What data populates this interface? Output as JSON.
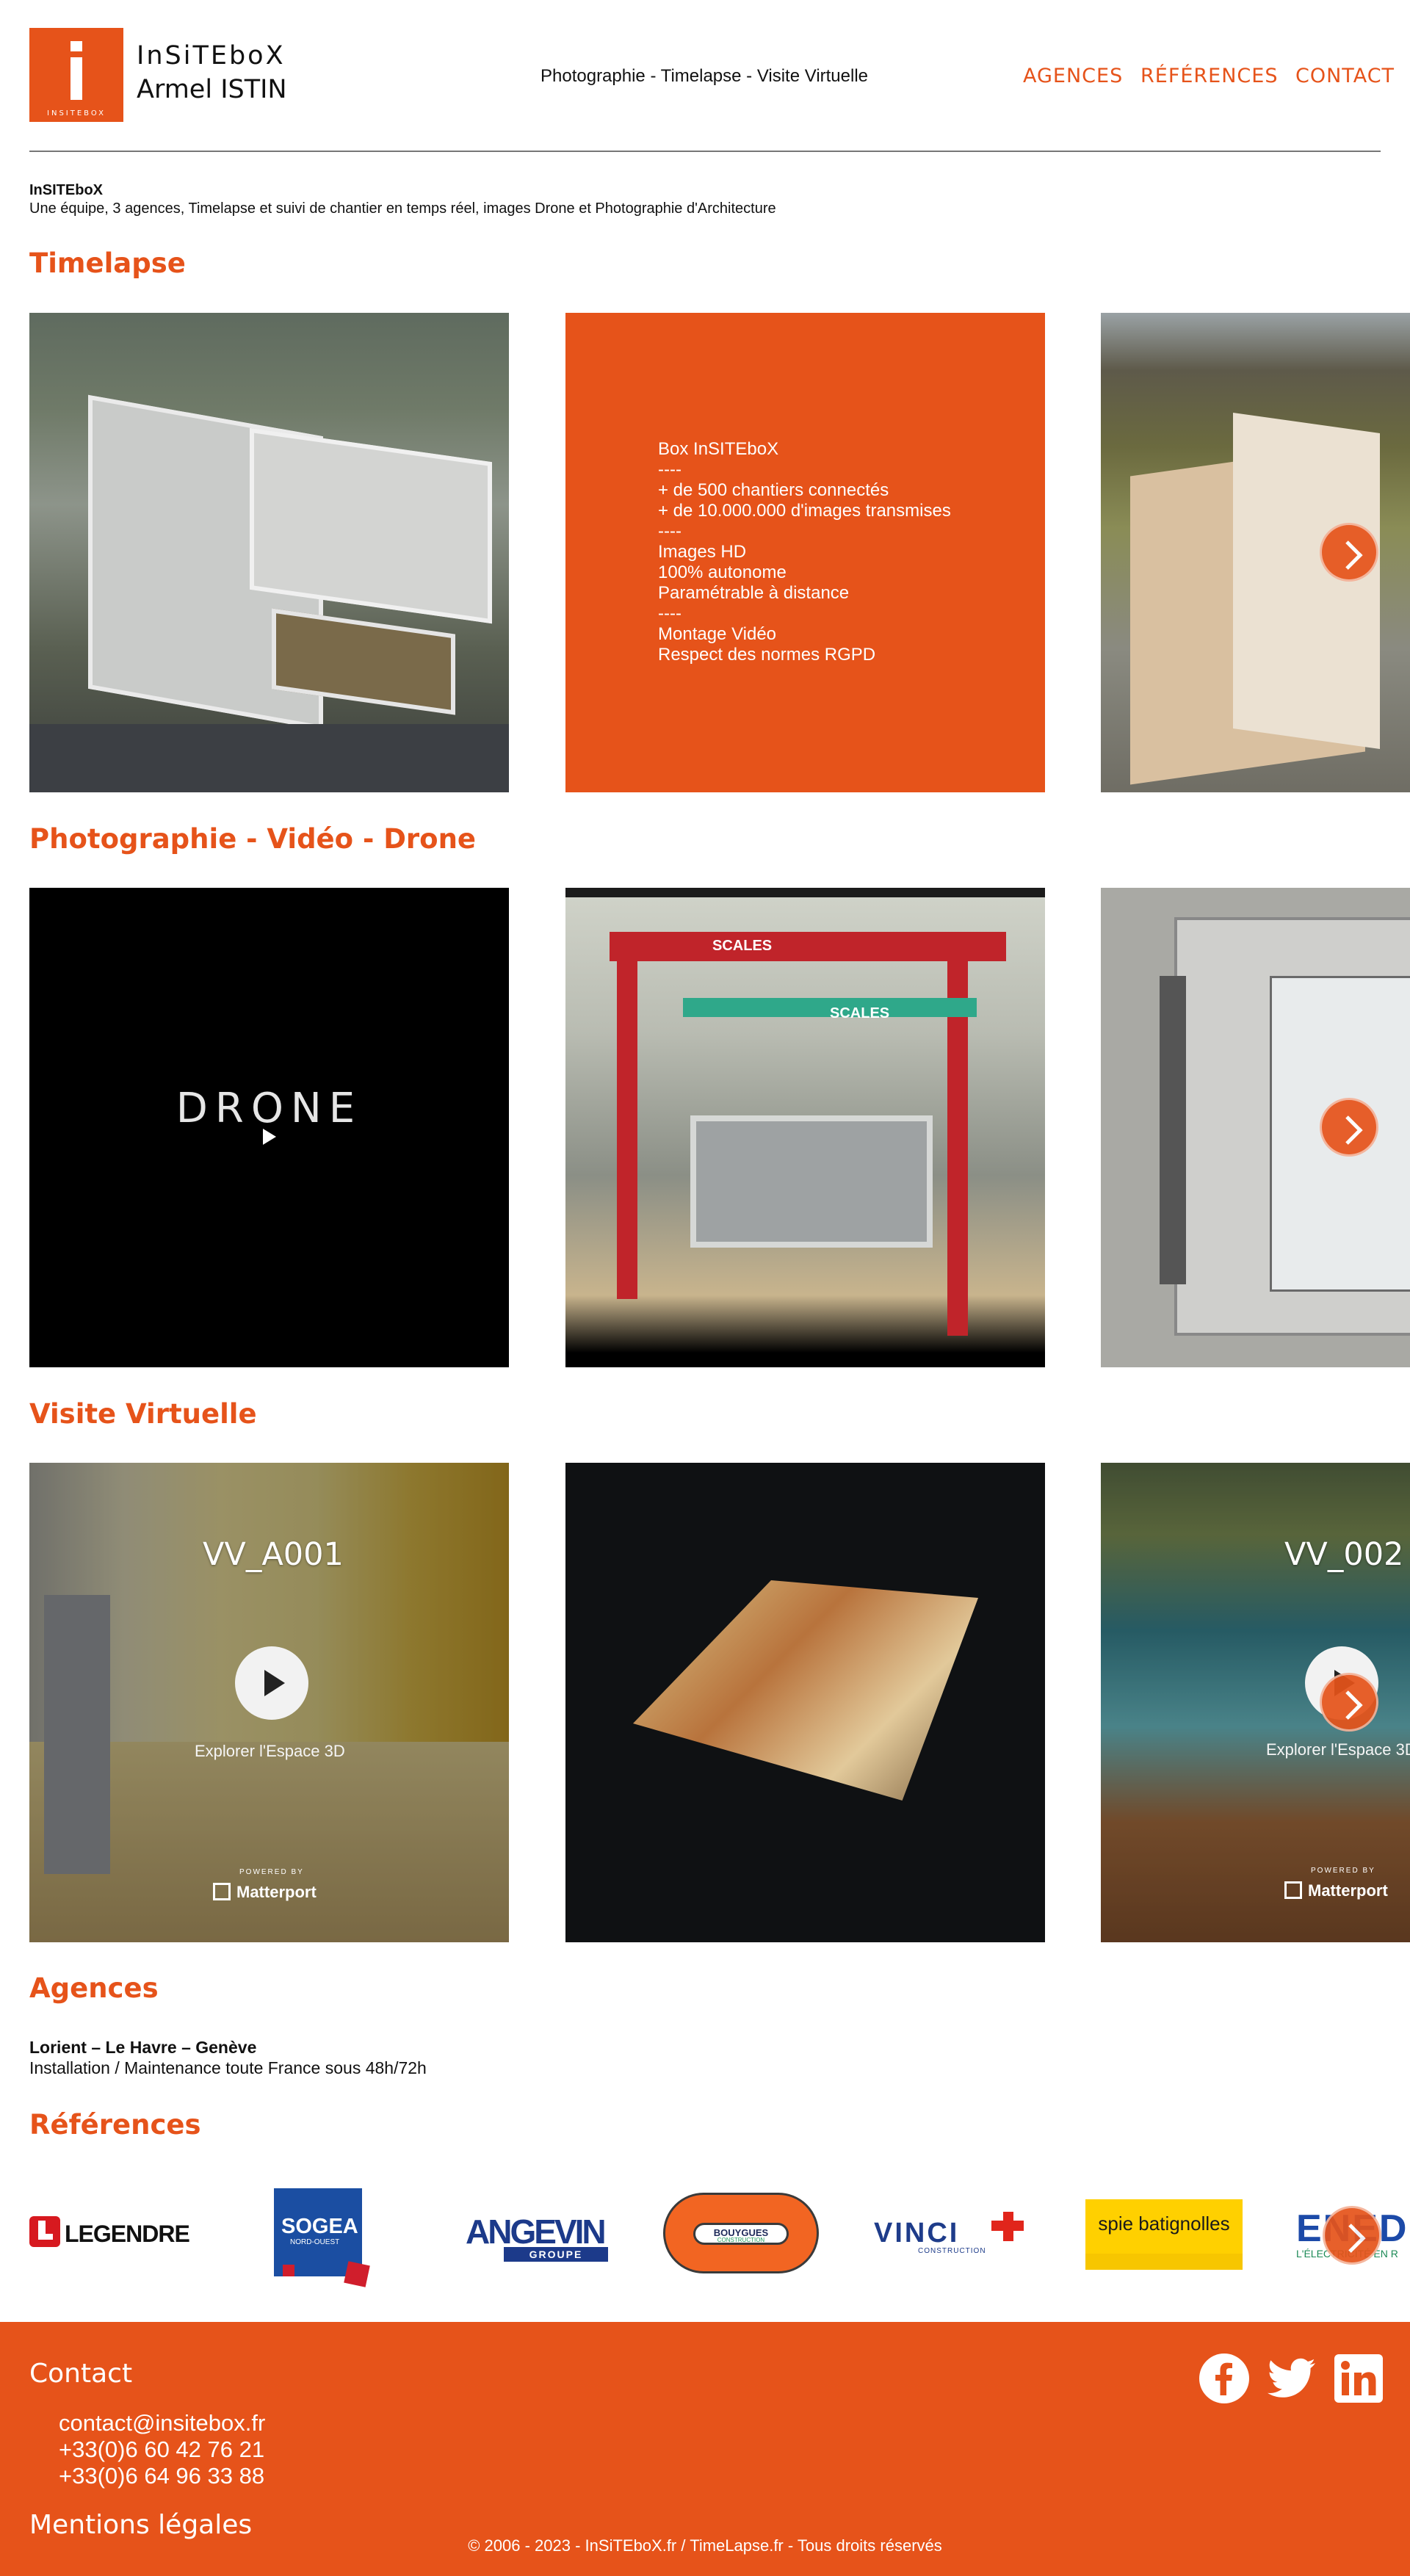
{
  "header": {
    "logo_small": "INSITEBOX",
    "brand_line1": "InSiTEboX",
    "brand_line2": "Armel ISTIN",
    "tagline": "Photographie - Timelapse - Visite Virtuelle",
    "nav": [
      "AGENCES",
      "RÉFÉRENCES",
      "CONTACT"
    ]
  },
  "intro": {
    "title": "InSITEboX",
    "text": "Une équipe, 3 agences, Timelapse et suivi de chantier en temps réel, images Drone et Photographie d'Architecture"
  },
  "sections": {
    "timelapse": "Timelapse",
    "photo": "Photographie - Vidéo - Drone",
    "virtual": "Visite Virtuelle",
    "agences": "Agences",
    "references": "Références"
  },
  "timelapse_info": [
    "Box InSITEboX",
    "----",
    "+ de 500 chantiers connectés",
    "+ de 10.000.000 d'images transmises",
    "----",
    "Images HD",
    "100% autonome",
    "Paramétrable à distance",
    "----",
    "Montage Vidéo",
    "Respect des normes RGPD"
  ],
  "photo": {
    "drone_label": "DRONE",
    "scales_1": "SCALES",
    "scales_2": "SCALES"
  },
  "virtual_tours": [
    {
      "title": "VV_A001",
      "explore": "Explorer l'Espace 3D",
      "powered": "POWERED BY",
      "brand": "Matterport"
    },
    {
      "title": "VV_002",
      "explore": "Explorer l'Espace 3D",
      "powered": "POWERED BY",
      "brand": "Matterport"
    }
  ],
  "agences": {
    "title": "Lorient – Le Havre – Genève",
    "text": "Installation / Maintenance toute France sous 48h/72h"
  },
  "references": {
    "legendre": "LEGENDRE",
    "sogea": "SOGEA",
    "sogea_sub": "NORD-OUEST",
    "angevin": "ANGEVIN",
    "angevin_sub": "GROUPE",
    "bouygues": "BOUYGUES",
    "bouygues_sub": "CONSTRUCTION",
    "vinci": "VINCI",
    "vinci_sub": "CONSTRUCTION",
    "spie": "spie batignolles",
    "enedis": "ENED",
    "enedis_sub": "L'ÉLECTRICITÉ EN R"
  },
  "footer": {
    "contact_title": "Contact",
    "email": "contact@insitebox.fr",
    "phone1": "+33(0)6 60 42 76 21",
    "phone2": "+33(0)6 64 96 33 88",
    "legal": "Mentions légales",
    "copyright": "© 2006 - 2023 - InSiTEboX.fr / TimeLapse.fr - Tous droits réservés"
  },
  "colors": {
    "accent": "#e6531a",
    "text": "#111111"
  },
  "icons": [
    "facebook-icon",
    "twitter-icon",
    "linkedin-icon",
    "chevron-right-icon",
    "play-icon"
  ]
}
